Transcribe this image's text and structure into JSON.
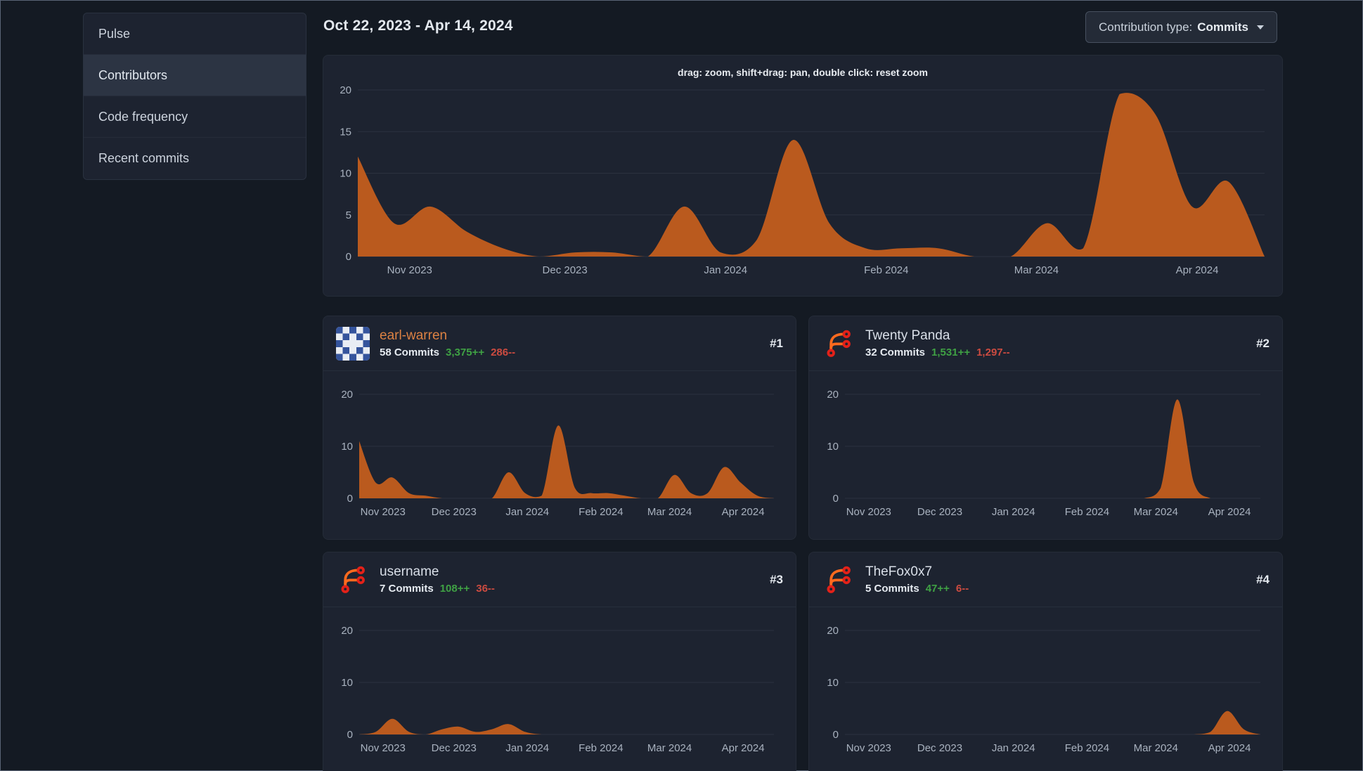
{
  "header": {
    "date_range": "Oct 22, 2023 - Apr 14, 2024",
    "contribution_type_label": "Contribution type:",
    "contribution_type_value": "Commits"
  },
  "sidebar": {
    "items": [
      {
        "label": "Pulse",
        "active": false
      },
      {
        "label": "Contributors",
        "active": true
      },
      {
        "label": "Code frequency",
        "active": false
      },
      {
        "label": "Recent commits",
        "active": false
      }
    ]
  },
  "contributors": [
    {
      "rank": "#1",
      "name": "earl-warren",
      "name_color": "#dd8243",
      "commits": "58 Commits",
      "additions": "3,375++",
      "deletions": "286--",
      "avatar_icon": "identicon-avatar"
    },
    {
      "rank": "#2",
      "name": "Twenty Panda",
      "name_color": "#d9dfe8",
      "commits": "32 Commits",
      "additions": "1,531++",
      "deletions": "1,297--",
      "avatar_icon": "forgejo-logo"
    },
    {
      "rank": "#3",
      "name": "username",
      "name_color": "#d9dfe8",
      "commits": "7 Commits",
      "additions": "108++",
      "deletions": "36--",
      "avatar_icon": "forgejo-logo"
    },
    {
      "rank": "#4",
      "name": "TheFox0x7",
      "name_color": "#d9dfe8",
      "commits": "5 Commits",
      "additions": "47++",
      "deletions": "6--",
      "avatar_icon": "forgejo-logo"
    }
  ],
  "colors": {
    "page_bg": "#141a23",
    "card_bg": "#1d2330",
    "accent_fill": "#ba5a1e",
    "link_orange": "#dd8243",
    "additions_green": "#3fa144",
    "deletions_red": "#cc4b40",
    "grid_line": "#2b323f",
    "axis_text": "#a9b2bf"
  },
  "chart_data": [
    {
      "type": "area",
      "name": "repository-contribution-activity",
      "hint": "drag: zoom, shift+drag: pan, double click: reset zoom",
      "x_unit": "week",
      "x_start": "Oct 22, 2023",
      "x_end": "Apr 14, 2024",
      "x_labels": [
        "Nov 2023",
        "Dec 2023",
        "Jan 2024",
        "Feb 2024",
        "Mar 2024",
        "Apr 2024"
      ],
      "x_label_positions": [
        1.43,
        5.71,
        10.14,
        14.57,
        18.71,
        23.14
      ],
      "values": [
        12,
        4,
        6,
        3,
        1,
        0,
        0.5,
        0.5,
        0,
        6,
        0.5,
        2,
        14,
        4,
        1,
        1,
        1,
        0,
        0,
        4,
        1,
        19.5,
        17,
        6,
        9,
        0
      ],
      "ylim": [
        0,
        20
      ],
      "yticks": [
        0,
        5,
        10,
        15,
        20
      ],
      "grid": true,
      "legend": "none",
      "fill_color": "#ba5a1e",
      "margins": {
        "l": 35,
        "r": 11,
        "t": 13,
        "b": 50
      }
    },
    {
      "type": "area",
      "name": "earl-warren-weekly-commits",
      "x_labels": [
        "Nov 2023",
        "Dec 2023",
        "Jan 2024",
        "Feb 2024",
        "Mar 2024",
        "Apr 2024"
      ],
      "x_label_positions": [
        1.43,
        5.71,
        10.14,
        14.57,
        18.71,
        23.14
      ],
      "values": [
        11,
        3,
        4,
        1,
        0.5,
        0,
        0,
        0,
        0,
        5,
        1,
        0.5,
        14,
        2,
        1,
        1,
        0.5,
        0,
        0,
        4.5,
        1,
        1,
        6,
        3,
        0.5,
        0
      ],
      "ylim": [
        0,
        20
      ],
      "yticks": [
        0,
        10,
        20
      ],
      "grid": true,
      "legend": "none",
      "fill_color": "#ba5a1e",
      "margins": {
        "l": 37,
        "r": 17,
        "t": 25,
        "b": 50
      }
    },
    {
      "type": "area",
      "name": "twenty-panda-weekly-commits",
      "x_labels": [
        "Nov 2023",
        "Dec 2023",
        "Jan 2024",
        "Feb 2024",
        "Mar 2024",
        "Apr 2024"
      ],
      "x_label_positions": [
        1.43,
        5.71,
        10.14,
        14.57,
        18.71,
        23.14
      ],
      "values": [
        0,
        0,
        0,
        0,
        0,
        0,
        0,
        0,
        0,
        0,
        0,
        0,
        0,
        0,
        0,
        0,
        0,
        0,
        0,
        2,
        19,
        3,
        0,
        0,
        0,
        0
      ],
      "ylim": [
        0,
        20
      ],
      "yticks": [
        0,
        10,
        20
      ],
      "grid": true,
      "legend": "none",
      "fill_color": "#ba5a1e",
      "margins": {
        "l": 37,
        "r": 17,
        "t": 25,
        "b": 50
      }
    },
    {
      "type": "area",
      "name": "username-weekly-commits",
      "x_labels": [
        "Nov 2023",
        "Dec 2023",
        "Jan 2024",
        "Feb 2024",
        "Mar 2024",
        "Apr 2024"
      ],
      "x_label_positions": [
        1.43,
        5.71,
        10.14,
        14.57,
        18.71,
        23.14
      ],
      "values": [
        0,
        0.5,
        3,
        0.5,
        0,
        1,
        1.5,
        0.5,
        1,
        2,
        0.5,
        0,
        0,
        0,
        0,
        0,
        0,
        0,
        0,
        0,
        0,
        0,
        0,
        0,
        0,
        0
      ],
      "ylim": [
        0,
        20
      ],
      "yticks": [
        0,
        10,
        20
      ],
      "grid": true,
      "legend": "none",
      "fill_color": "#ba5a1e",
      "margins": {
        "l": 37,
        "r": 17,
        "t": 25,
        "b": 50
      }
    },
    {
      "type": "area",
      "name": "thefox0x7-weekly-commits",
      "x_labels": [
        "Nov 2023",
        "Dec 2023",
        "Jan 2024",
        "Feb 2024",
        "Mar 2024",
        "Apr 2024"
      ],
      "x_label_positions": [
        1.43,
        5.71,
        10.14,
        14.57,
        18.71,
        23.14
      ],
      "values": [
        0,
        0,
        0,
        0,
        0,
        0,
        0,
        0,
        0,
        0,
        0,
        0,
        0,
        0,
        0,
        0,
        0,
        0,
        0,
        0,
        0,
        0,
        0.5,
        4.5,
        1,
        0
      ],
      "ylim": [
        0,
        20
      ],
      "yticks": [
        0,
        10,
        20
      ],
      "grid": true,
      "legend": "none",
      "fill_color": "#ba5a1e",
      "margins": {
        "l": 37,
        "r": 17,
        "t": 25,
        "b": 50
      }
    }
  ]
}
